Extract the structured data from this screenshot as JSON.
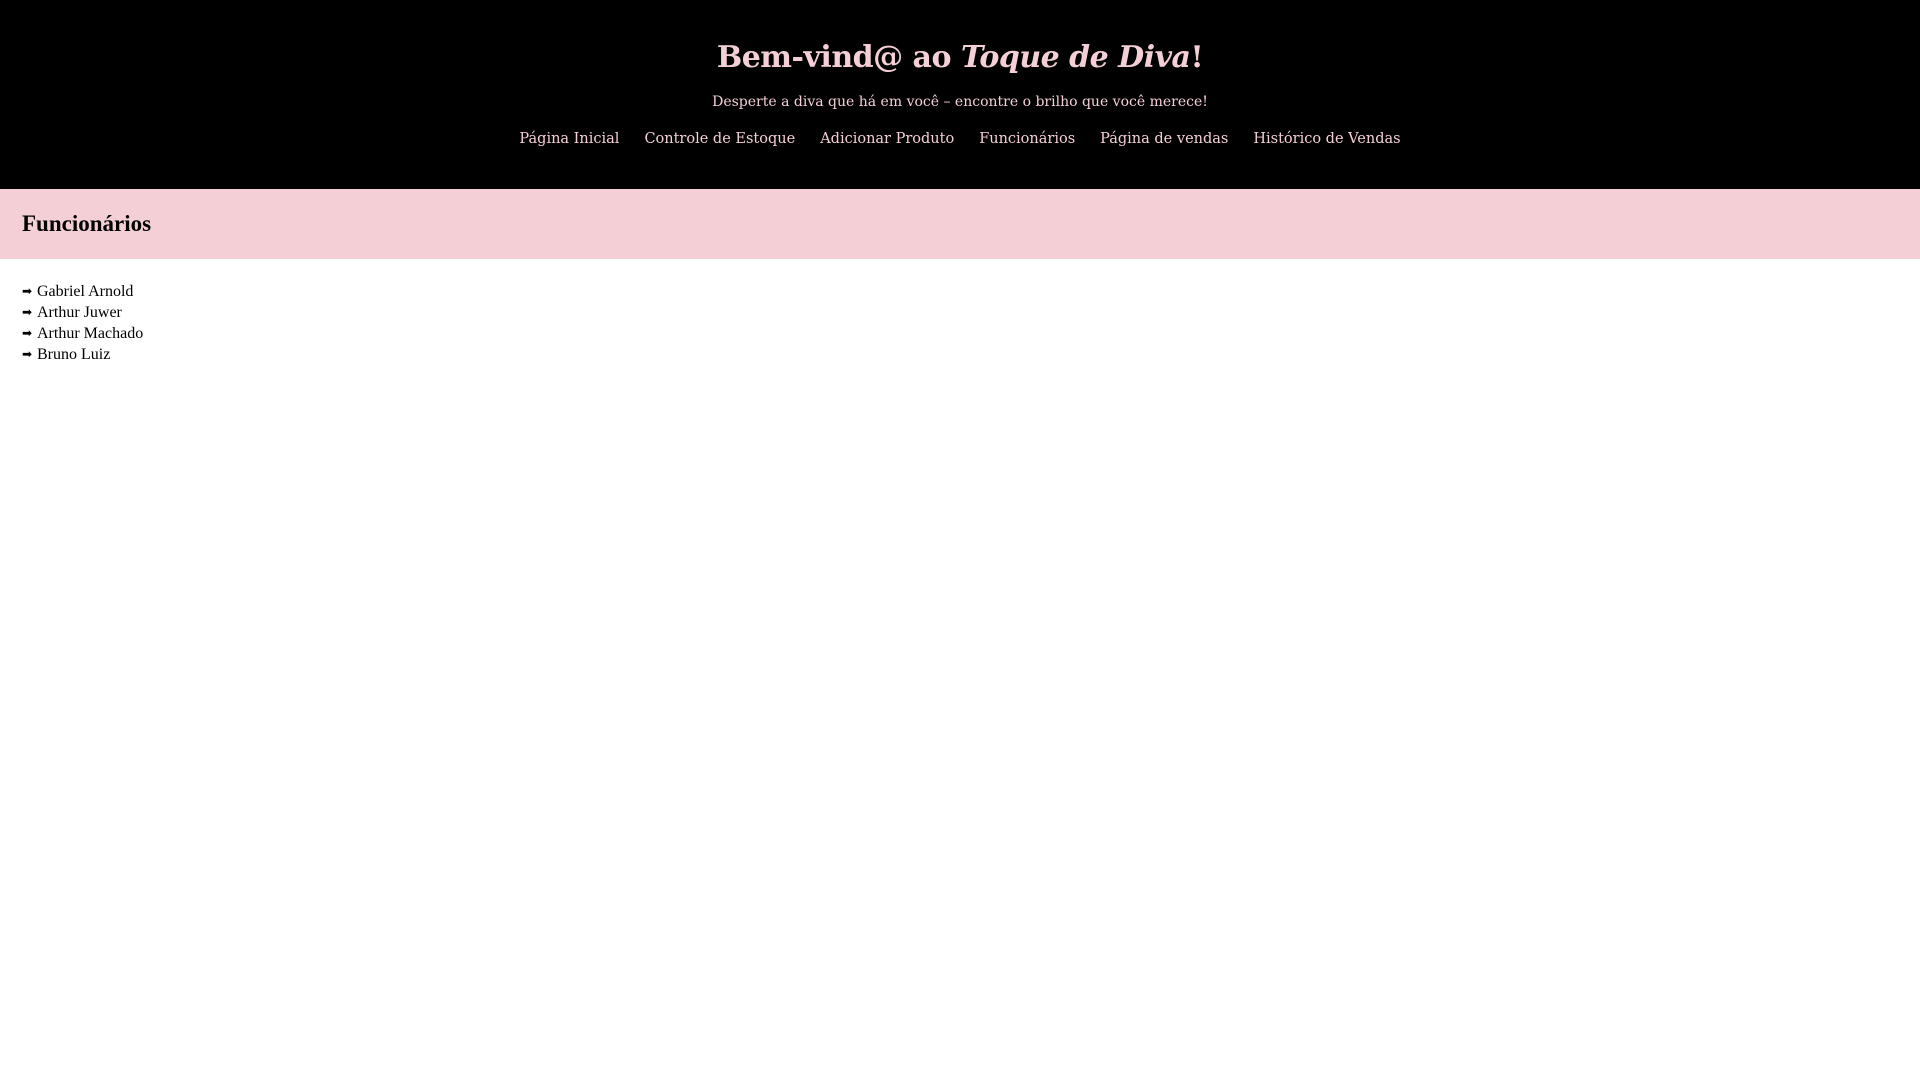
{
  "colors": {
    "header_bg": "#000000",
    "accent_pink": "#f4cfd6",
    "text_dark": "#000000",
    "page_bg": "#ffffff"
  },
  "header": {
    "title_prefix": "Bem-vind@ ao ",
    "title_brand": "Toque de Diva",
    "title_suffix": "!",
    "tagline": "Desperte a diva que há em você – encontre o brilho que você merece!"
  },
  "nav": {
    "items": [
      {
        "label": "Página Inicial"
      },
      {
        "label": "Controle de Estoque"
      },
      {
        "label": "Adicionar Produto"
      },
      {
        "label": "Funcionários"
      },
      {
        "label": "Página de vendas"
      },
      {
        "label": "Histórico de Vendas"
      }
    ]
  },
  "section": {
    "title": "Funcionários"
  },
  "employees": {
    "bullet_icon": "right-arrow-icon",
    "items": [
      {
        "name": "Gabriel Arnold"
      },
      {
        "name": "Arthur Juwer"
      },
      {
        "name": "Arthur Machado"
      },
      {
        "name": "Bruno Luiz"
      }
    ]
  }
}
